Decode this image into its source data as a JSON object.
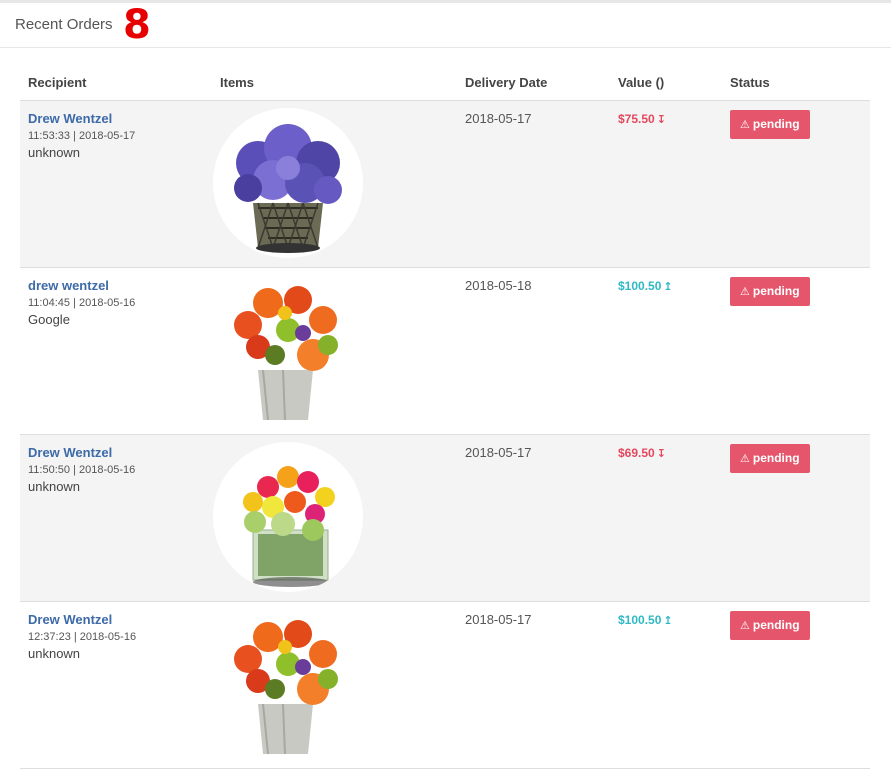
{
  "panel": {
    "title": "Recent Orders",
    "count": "8"
  },
  "table": {
    "headers": [
      "Recipient",
      "Items",
      "Delivery Date",
      "Value ()",
      "Status"
    ],
    "rows": [
      {
        "recipient": "Drew Wentzel",
        "time": "11:53:33 | 2018-05-17",
        "source": "unknown",
        "item_icon": "purple-hydrangea-arrangement",
        "delivery_date": "2018-05-17",
        "value": "$75.50",
        "trend": "down",
        "trend_icon": "↧",
        "status": "pending",
        "status_icon": "⚠"
      },
      {
        "recipient": "drew wentzel",
        "time": "11:04:45 | 2018-05-16",
        "source": "Google",
        "item_icon": "orange-tulip-rose-bouquet",
        "delivery_date": "2018-05-18",
        "value": "$100.50",
        "trend": "up",
        "trend_icon": "↥",
        "status": "pending",
        "status_icon": "⚠"
      },
      {
        "recipient": "Drew Wentzel",
        "time": "11:50:50 | 2018-05-16",
        "source": "unknown",
        "item_icon": "rose-hydrangea-cube-vase",
        "delivery_date": "2018-05-17",
        "value": "$69.50",
        "trend": "down",
        "trend_icon": "↧",
        "status": "pending",
        "status_icon": "⚠"
      },
      {
        "recipient": "Drew Wentzel",
        "time": "12:37:23 | 2018-05-16",
        "source": "unknown",
        "item_icon": "orange-tulip-rose-bouquet",
        "delivery_date": "2018-05-17",
        "value": "$100.50",
        "trend": "up",
        "trend_icon": "↥",
        "status": "pending",
        "status_icon": "⚠"
      }
    ]
  },
  "colors": {
    "accent_link": "#3d6aa8",
    "value_down": "#e4485e",
    "value_up": "#2fb9c5",
    "badge": "#e5566c",
    "count": "#e60000"
  }
}
